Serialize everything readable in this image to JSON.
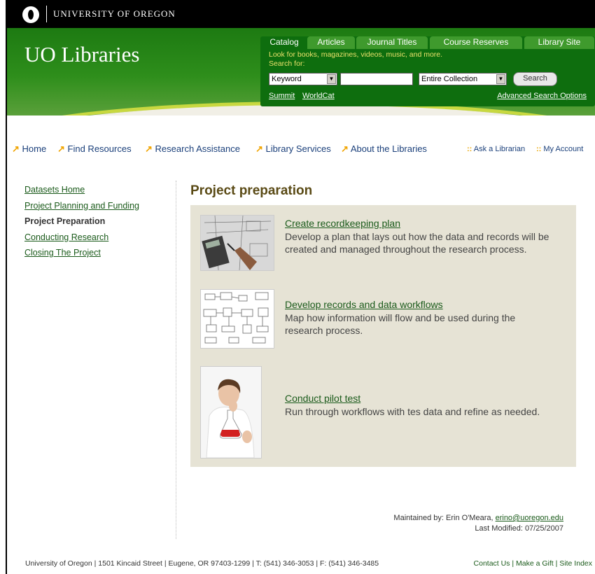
{
  "header": {
    "university": "UNIVERSITY OF OREGON",
    "site_title": "UO Libraries"
  },
  "search": {
    "tabs": [
      "Catalog",
      "Articles",
      "Journal Titles",
      "Course Reserves",
      "Library Site"
    ],
    "active_tab": "Catalog",
    "hint": "Look for books, magazines, videos, music, and more.",
    "search_for_label": "Search for:",
    "type_select": "Keyword",
    "query_value": "",
    "scope_select": "Entire Collection",
    "search_button": "Search",
    "link_summit": "Summit",
    "link_worldcat": "WorldCat",
    "link_advanced": "Advanced Search Options"
  },
  "nav": {
    "items": [
      "Home",
      "Find Resources",
      "Research Assistance",
      "Library Services",
      "About the Libraries"
    ],
    "ask": "Ask a Librarian",
    "account": "My Account",
    "separator": "::"
  },
  "sidebar": {
    "items": [
      {
        "label": "Datasets Home"
      },
      {
        "label": "Project Planning and Funding"
      },
      {
        "label": "Project Preparation"
      },
      {
        "label": "Conducting Research"
      },
      {
        "label": "Closing The Project"
      }
    ],
    "current": "Project Preparation"
  },
  "main": {
    "title": "Project preparation",
    "items": [
      {
        "title": "Create recordkeeping plan",
        "desc": "Develop a plan that lays out how the data and records will be created and managed throughout the research process.",
        "image": "blueprint-calculator-image"
      },
      {
        "title": "Develop records and data workflows",
        "desc": "Map how information will flow and be used during the research process.",
        "image": "workflow-diagram-image"
      },
      {
        "title": "Conduct pilot test",
        "desc": "Run through workflows with tes data and refine as needed.",
        "image": "scientist-flask-image"
      }
    ],
    "maintained_by": "Maintained by: Erin O'Meara,",
    "email": "erino@uoregon.edu",
    "last_modified": "Last Modified: 07/25/2007"
  },
  "footer": {
    "address": "University of Oregon | 1501 Kincaid Street | Eugene, OR 97403-1299 | T: (541) 346-3053 | F: (541) 346-3485",
    "links": [
      "Contact Us",
      "Make a Gift",
      "Site Index"
    ],
    "link_separator": "|"
  },
  "colors": {
    "banner_green": "#2e8e1b",
    "panel_green": "#0e6e0e",
    "nav_arrow": "#f0a400",
    "content_bg": "#e6e3d5",
    "title_brown": "#5a4a15"
  }
}
